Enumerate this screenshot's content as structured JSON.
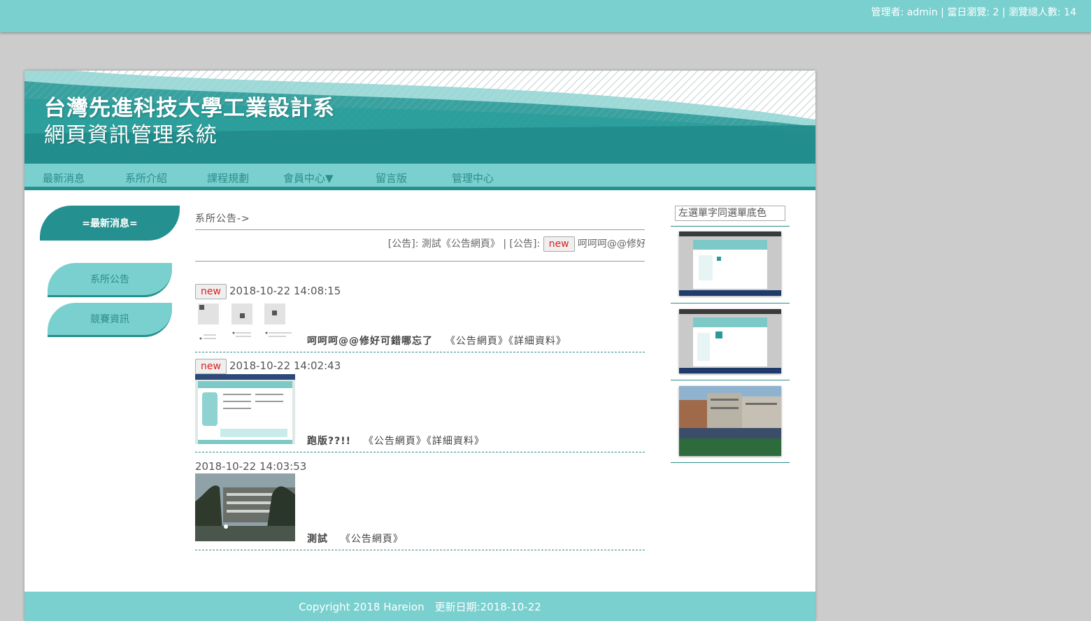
{
  "topbar": {
    "stats": "管理者: admin | 當日瀏覽: 2 | 瀏覽總人數: 14"
  },
  "banner": {
    "title": "台灣先進科技大學工業設計系",
    "subtitle": "網頁資訊管理系統"
  },
  "nav": {
    "items": [
      "最新消息",
      "系所介紹",
      "課程規劃",
      "會員中心▼",
      "留言版",
      "管理中心"
    ]
  },
  "leftmenu": {
    "heading": "=最新消息=",
    "items": [
      "系所公告",
      "競賽資訊"
    ]
  },
  "main": {
    "breadcrumb": "系所公告->",
    "marquee": {
      "part1": "[公告]: 測試《公告網頁》 | [公告]:",
      "new_label": "new",
      "part2": "呵呵呵@@修好可錯哪忘了"
    },
    "posts": [
      {
        "new_label": "new",
        "date": "2018-10-22 14:08:15",
        "text": "呵呵呵@@修好可錯哪忘了",
        "link1": "《公告網頁》",
        "link2": "《詳細資料》"
      },
      {
        "new_label": "new",
        "date": "2018-10-22 14:02:43",
        "text": "跑版??!!",
        "link1": "《公告網頁》",
        "link2": "《詳細資料》"
      },
      {
        "new_label": "",
        "date": "2018-10-22 14:03:53",
        "text": "測試",
        "link1": "《公告網頁》",
        "link2": ""
      }
    ]
  },
  "right": {
    "broken_image_alt": "左選單字同選單底色"
  },
  "footer": {
    "text": "Copyright 2018 Hareion　更新日期:2018-10-22"
  },
  "colors": {
    "teal_light": "#79d0cf",
    "teal_dark": "#24908f",
    "page_bg": "#cccccc"
  }
}
